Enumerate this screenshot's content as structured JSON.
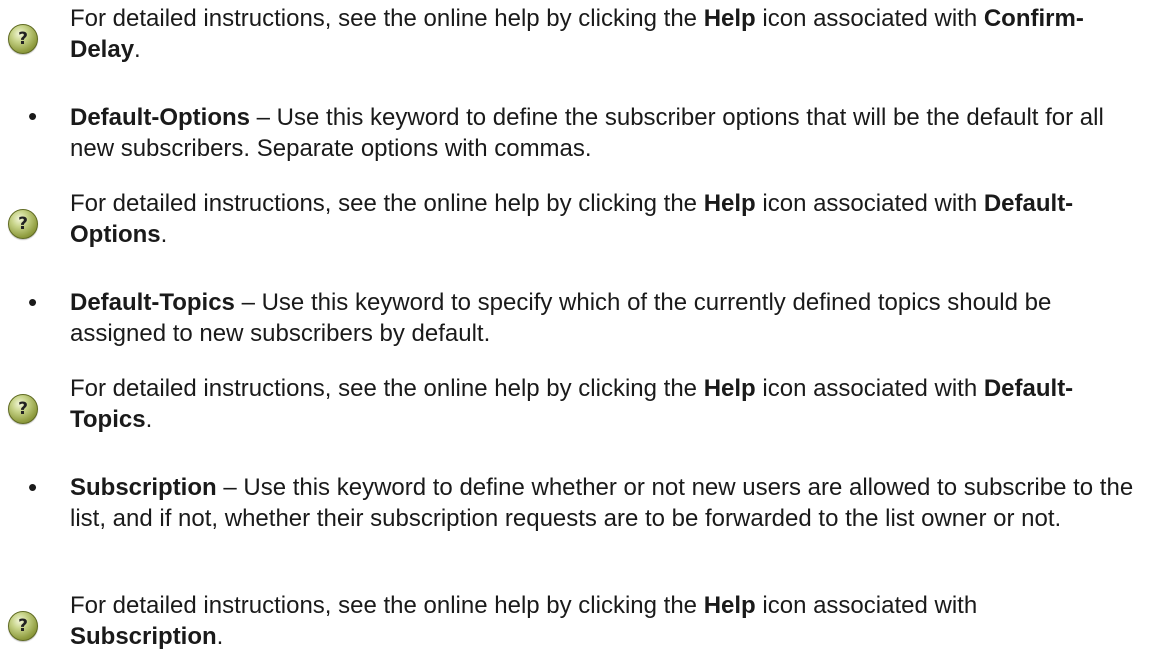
{
  "blocks": [
    {
      "type": "help",
      "before": "For detailed instructions, see the online help by clicking the ",
      "help_label": "Help",
      "middle": " icon associated with ",
      "keyword": "Confirm-Delay",
      "after": "."
    },
    {
      "type": "bullet",
      "bullet_char": "•",
      "keyword": "Default-Options",
      "text": " – Use this keyword to define the subscriber options that will be the default for all new subscribers. Separate options with commas."
    },
    {
      "type": "help",
      "before": "For detailed instructions, see the online help by clicking the ",
      "help_label": "Help",
      "middle": " icon associated with ",
      "keyword": "Default-Options",
      "after": "."
    },
    {
      "type": "bullet",
      "bullet_char": "•",
      "keyword": "Default-Topics",
      "text": " – Use this keyword to specify which of the currently defined topics should be assigned to new subscribers by default."
    },
    {
      "type": "help",
      "before": "For detailed instructions, see the online help by clicking the ",
      "help_label": "Help",
      "middle": " icon associated with ",
      "keyword": "Default-Topics",
      "after": "."
    },
    {
      "type": "bullet",
      "bullet_char": "•",
      "keyword": "Subscription",
      "text": " – Use this keyword to define whether or not new users are allowed to subscribe to the list, and if not, whether their subscription requests are to be forwarded to the list owner or not."
    },
    {
      "type": "help",
      "before": "For detailed instructions, see the online help by clicking the ",
      "help_label": "Help",
      "middle": " icon associated with ",
      "keyword": "Subscription",
      "after": "."
    }
  ],
  "icon": {
    "name": "help-icon",
    "glyph": "?"
  }
}
